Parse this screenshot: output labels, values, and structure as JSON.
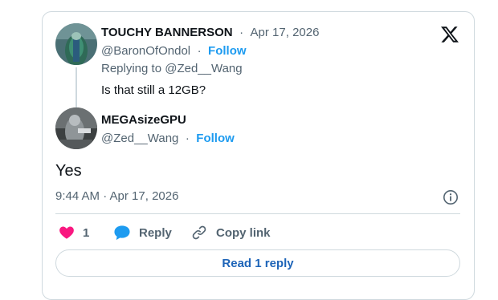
{
  "parent_tweet": {
    "display_name": "TOUCHY BANNERSON",
    "separator": "·",
    "date": "Apr 17, 2026",
    "handle": "@BaronOfOndol",
    "follow_label": "Follow",
    "replying_to": "Replying to @Zed__Wang",
    "text": "Is that still a 12GB?"
  },
  "main_tweet": {
    "display_name": "MEGAsizeGPU",
    "handle": "@Zed__Wang",
    "follow_label": "Follow",
    "text": "Yes",
    "timestamp": "9:44 AM · Apr 17, 2026"
  },
  "actions": {
    "like_count": "1",
    "reply_label": "Reply",
    "copy_link_label": "Copy link"
  },
  "read_replies_label": "Read 1 reply",
  "icons": {
    "logo": "x-logo-icon",
    "info": "info-icon",
    "like": "heart-icon",
    "reply": "speech-bubble-icon",
    "copy_link": "link-icon"
  },
  "colors": {
    "accent": "#1d9bf0",
    "like": "#f91880",
    "muted": "#536471",
    "border": "#cfd9de",
    "button_text": "#1d64b8"
  }
}
